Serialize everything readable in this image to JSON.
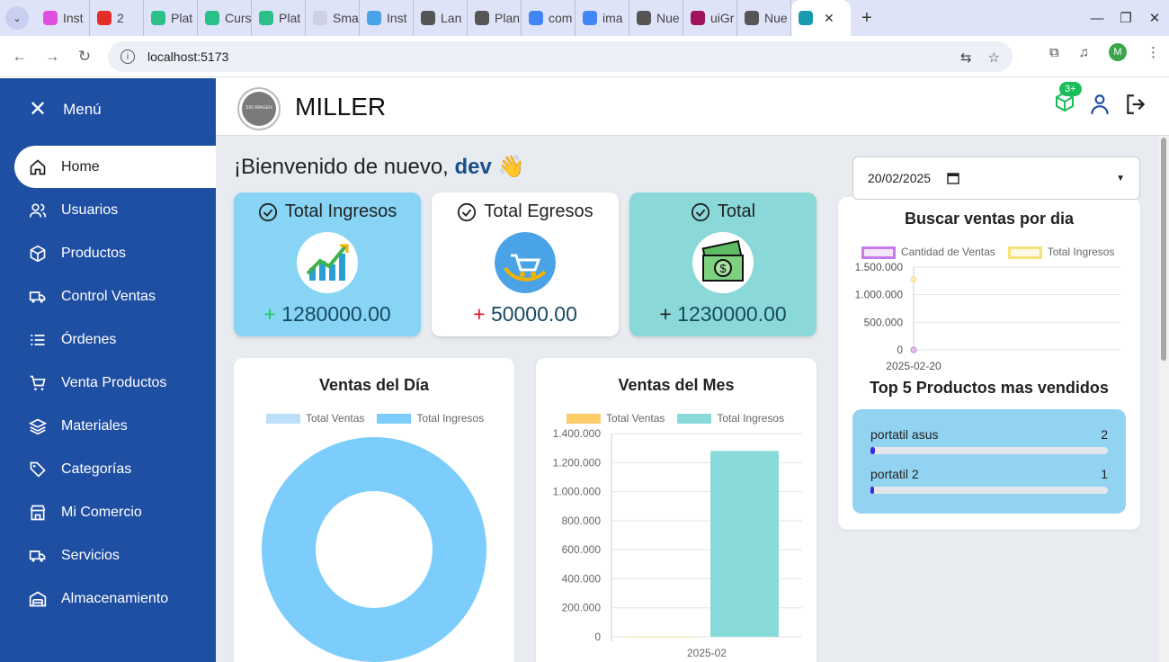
{
  "browser": {
    "tabs": [
      {
        "label": "Inst",
        "color": "#e04ee0"
      },
      {
        "label": "2",
        "color": "#e52d27"
      },
      {
        "label": "Plat",
        "color": "#2bc08a"
      },
      {
        "label": "Curs",
        "color": "#2bc08a"
      },
      {
        "label": "Plat",
        "color": "#2bc08a"
      },
      {
        "label": "Sma",
        "color": "#cfcfe8"
      },
      {
        "label": "Inst",
        "color": "#4aa3e6"
      },
      {
        "label": "Lan",
        "color": "#555555"
      },
      {
        "label": "Plan",
        "color": "#555555"
      },
      {
        "label": "com",
        "color": "#4285f4"
      },
      {
        "label": "ima",
        "color": "#4285f4"
      },
      {
        "label": "Nue",
        "color": "#555555"
      },
      {
        "label": "uiGr",
        "color": "#a2135d"
      },
      {
        "label": "Nue",
        "color": "#555555"
      }
    ],
    "active_tab_label": "",
    "url": "localhost:5173",
    "profile_initial": "M"
  },
  "sidebar": {
    "menu_label": "Menú",
    "items": [
      {
        "label": "Home",
        "icon": "home-icon"
      },
      {
        "label": "Usuarios",
        "icon": "users-icon"
      },
      {
        "label": "Productos",
        "icon": "box-icon"
      },
      {
        "label": "Control Ventas",
        "icon": "truck-icon"
      },
      {
        "label": "Órdenes",
        "icon": "list-icon"
      },
      {
        "label": "Venta Productos",
        "icon": "cart-icon"
      },
      {
        "label": "Materiales",
        "icon": "layers-icon"
      },
      {
        "label": "Categorías",
        "icon": "tag-icon"
      },
      {
        "label": "Mi Comercio",
        "icon": "store-icon"
      },
      {
        "label": "Servicios",
        "icon": "truck-icon"
      },
      {
        "label": "Almacenamiento",
        "icon": "warehouse-icon"
      }
    ],
    "active_index": 0
  },
  "header": {
    "logo_text": "SIN IMAGEN",
    "brand": "MILLER",
    "notification_badge": "3+"
  },
  "main": {
    "welcome_prefix": "¡Bienvenido de nuevo,",
    "welcome_user": "dev",
    "welcome_emoji": "👋",
    "cards": [
      {
        "title": "Total Ingresos",
        "sign": "+",
        "value": "1280000.00",
        "bg": "#87d4f5",
        "sign_color": "#1fc85a"
      },
      {
        "title": "Total Egresos",
        "sign": "+",
        "value": "50000.00",
        "bg": "#ffffff",
        "sign_color": "#e0162b"
      },
      {
        "title": "Total",
        "sign": "+",
        "value": "1230000.00",
        "bg": "#8ad8d8",
        "sign_color": "#222222"
      }
    ],
    "date_value": "20/02/2025"
  },
  "chart_data": [
    {
      "type": "pie",
      "title": "Ventas del Día",
      "series": [
        {
          "name": "Total Ventas",
          "color": "#bde0fa",
          "value": 1
        },
        {
          "name": "Total Ingresos",
          "color": "#7ccdfc",
          "value": 1280000
        }
      ]
    },
    {
      "type": "bar",
      "title": "Ventas del Mes",
      "categories": [
        "2025-02"
      ],
      "series": [
        {
          "name": "Total Ventas",
          "color": "#ffcc6a",
          "values": [
            1
          ]
        },
        {
          "name": "Total Ingresos",
          "color": "#88dbd9",
          "values": [
            1280000
          ]
        }
      ],
      "ylim": [
        0,
        1400000
      ],
      "yticks": [
        "0",
        "200.000",
        "400.000",
        "600.000",
        "800.000",
        "1.000.000",
        "1.200.000",
        "1.400.000"
      ]
    },
    {
      "type": "line",
      "title": "Buscar ventas por dia",
      "x": [
        "2025-02-20"
      ],
      "series": [
        {
          "name": "Cantidad de Ventas",
          "color": "#c77be8",
          "values": [
            1
          ]
        },
        {
          "name": "Total Ingresos",
          "color": "#f5e27a",
          "values": [
            1280000
          ]
        }
      ],
      "ylim": [
        0,
        1500000
      ],
      "yticks": [
        "0",
        "500.000",
        "1.000.000",
        "1.500.000"
      ]
    }
  ],
  "top_products": {
    "title": "Top 5 Productos mas vendidos",
    "items": [
      {
        "name": "portatil asus",
        "count": "2",
        "fraction": 0.02
      },
      {
        "name": "portatil 2",
        "count": "1",
        "fraction": 0.01
      }
    ]
  }
}
